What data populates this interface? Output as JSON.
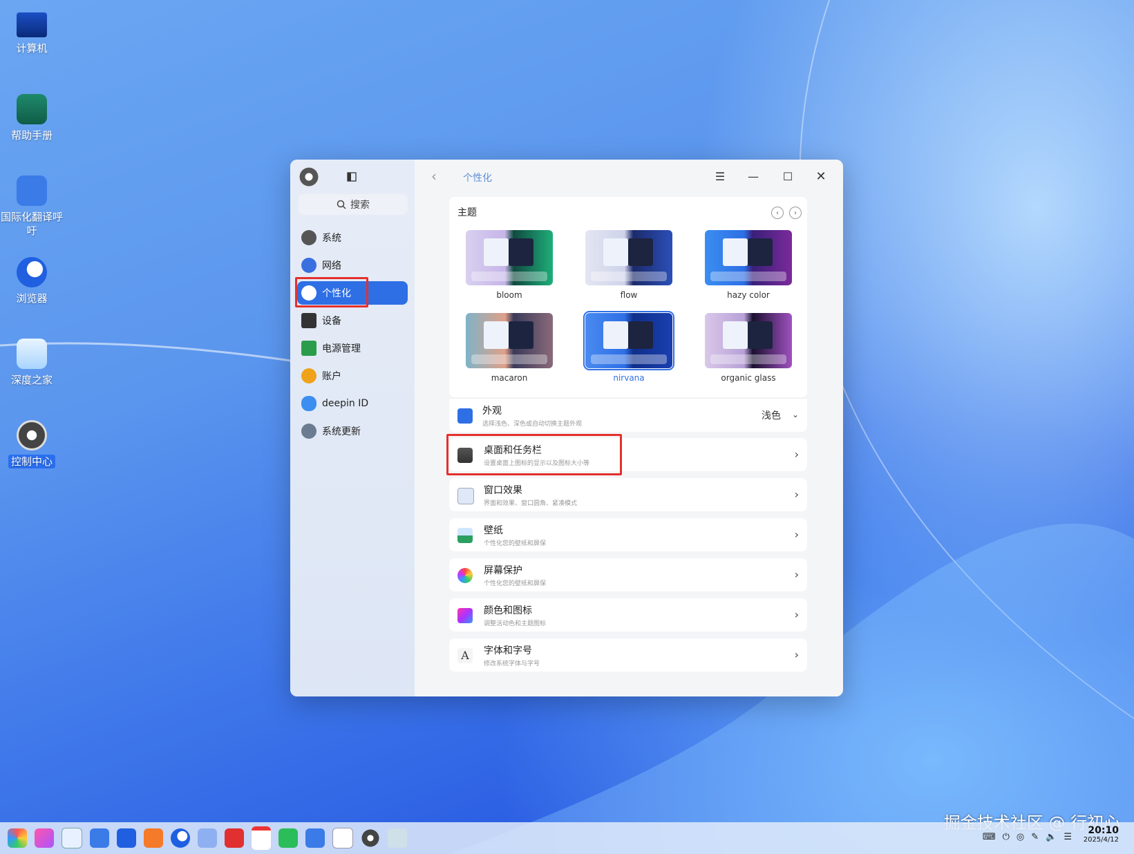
{
  "desktop": {
    "icons": [
      {
        "label": "计算机",
        "icon": "monitor-icon"
      },
      {
        "label": "帮助手册",
        "icon": "help-manual-icon"
      },
      {
        "label": "国际化翻译呼吁",
        "icon": "translate-icon"
      },
      {
        "label": "浏览器",
        "icon": "browser-icon"
      },
      {
        "label": "深度之家",
        "icon": "deepin-home-icon"
      },
      {
        "label": "控制中心",
        "icon": "gear-icon"
      }
    ]
  },
  "window": {
    "breadcrumb": "个性化",
    "search_placeholder": "搜索",
    "nav": [
      {
        "label": "系统",
        "icon": "system-icon"
      },
      {
        "label": "网络",
        "icon": "network-icon"
      },
      {
        "label": "个性化",
        "icon": "personalization-icon",
        "active": true
      },
      {
        "label": "设备",
        "icon": "device-icon"
      },
      {
        "label": "电源管理",
        "icon": "power-icon"
      },
      {
        "label": "账户",
        "icon": "account-icon"
      },
      {
        "label": "deepin ID",
        "icon": "cloud-icon"
      },
      {
        "label": "系统更新",
        "icon": "update-icon"
      }
    ],
    "theme_section": {
      "title": "主题",
      "themes": [
        {
          "name": "bloom",
          "selected": false
        },
        {
          "name": "flow",
          "selected": false
        },
        {
          "name": "hazy color",
          "selected": false
        },
        {
          "name": "macaron",
          "selected": false
        },
        {
          "name": "nirvana",
          "selected": true
        },
        {
          "name": "organic glass",
          "selected": false
        }
      ]
    },
    "appearance": {
      "title": "外观",
      "subtitle": "选择浅色、深色或自动切换主题外观",
      "value": "浅色"
    },
    "settings_rows": [
      {
        "title": "桌面和任务栏",
        "subtitle": "设置桌面上图标的显示以及图标大小等"
      },
      {
        "title": "窗口效果",
        "subtitle": "界面和效果、窗口圆角、紧凑模式"
      },
      {
        "title": "壁纸",
        "subtitle": "个性化您的壁纸和屏保"
      },
      {
        "title": "屏幕保护",
        "subtitle": "个性化您的壁纸和屏保"
      },
      {
        "title": "颜色和图标",
        "subtitle": "调整活动色和主题图标"
      },
      {
        "title": "字体和字号",
        "subtitle": "修改系统字体与字号"
      }
    ]
  },
  "taskbar": {
    "time": "20:10",
    "date": "2025/4/12"
  },
  "watermark": "掘金技术社区 @ 行初心",
  "colors": {
    "accent": "#2e6fe6",
    "highlight_box": "#e5302b"
  }
}
